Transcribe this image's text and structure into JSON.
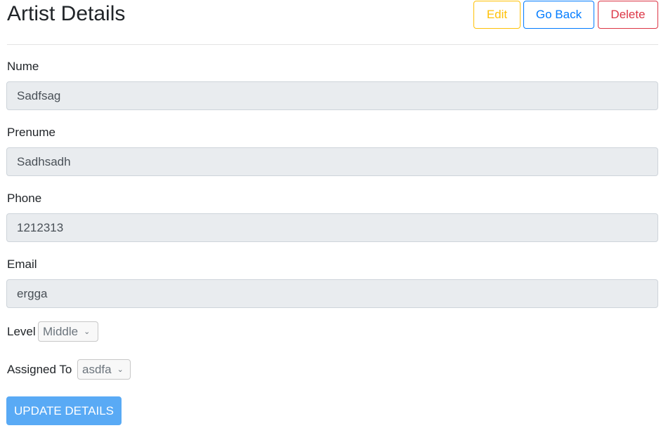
{
  "page": {
    "title": "Artist Details"
  },
  "actions": {
    "edit_label": "Edit",
    "back_label": "Go Back",
    "delete_label": "Delete"
  },
  "form": {
    "fields": [
      {
        "label": "Nume",
        "value": "Sadfsag"
      },
      {
        "label": "Prenume",
        "value": "Sadhsadh"
      },
      {
        "label": "Phone",
        "value": "1212313"
      },
      {
        "label": "Email",
        "value": "ergga"
      }
    ],
    "level": {
      "label": "Level",
      "selected": "Middle"
    },
    "assigned": {
      "label": "Assigned To",
      "selected": "asdfa"
    },
    "update_label": "UPDATE DETAILS"
  },
  "colors": {
    "edit": "#ffc107",
    "back": "#007bff",
    "delete": "#dc3545",
    "update": "#59aaf5",
    "readonly_bg": "#e9ecef"
  },
  "icons": {
    "select_chevron": "chevron-down-icon"
  }
}
